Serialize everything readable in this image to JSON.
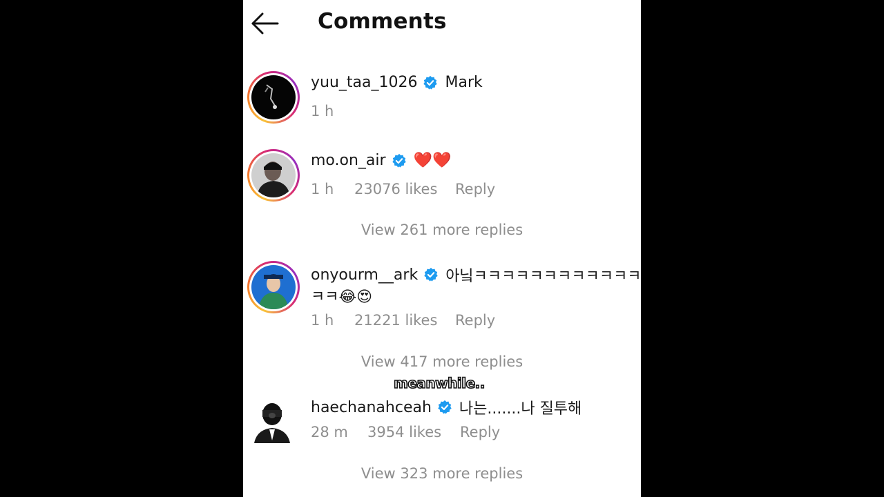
{
  "header": {
    "title": "Comments",
    "back_icon": "arrow-left-icon"
  },
  "comments": [
    {
      "username": "yuu_taa_1026",
      "verified": true,
      "text": "Mark",
      "time": "1 h",
      "likes": "",
      "reply": ""
    },
    {
      "username": "mo.on_air",
      "verified": true,
      "text": "❤️❤️",
      "time": "1 h",
      "likes": "23076 likes",
      "reply": "Reply",
      "view_more": "View 261 more replies"
    },
    {
      "username": "onyourm__ark",
      "verified": true,
      "text": "아닠ㅋㅋㅋㅋㅋㅋㅋㅋㅋㅋㅋㅋ",
      "text_line2": "ㅋㅋ😂😍",
      "time": "1 h",
      "likes": "21221 likes",
      "reply": "Reply",
      "view_more": "View 417 more replies"
    },
    {
      "username": "haechanahceah",
      "verified": true,
      "text": "나는.......나 질투해",
      "time": "28 m",
      "likes": "3954 likes",
      "reply": "Reply",
      "view_more": "View 323 more replies"
    }
  ],
  "overlay": {
    "caption": "meanwhile..",
    "emoji": "😅"
  },
  "colors": {
    "background": "#000000",
    "panel": "#ffffff",
    "text": "#1a1a1a",
    "secondary": "#8e8e8e",
    "verified": "#1d9bf0"
  }
}
